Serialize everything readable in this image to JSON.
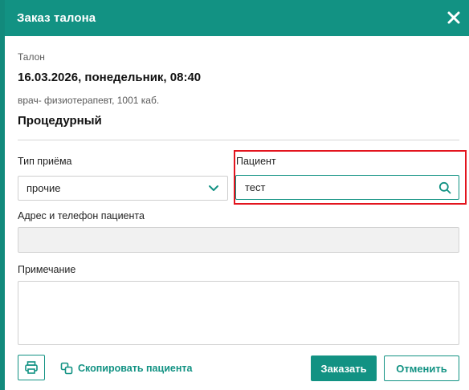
{
  "dialog": {
    "title": "Заказ талона",
    "close_icon": "close-icon"
  },
  "ticket": {
    "section_label": "Талон",
    "datetime": "16.03.2026, понедельник, 08:40",
    "doctor": "врач- физиотерапевт, 1001 каб.",
    "cabinet_name": "Процедурный"
  },
  "form": {
    "visit_type_label": "Тип приёма",
    "visit_type_value": "прочие",
    "patient_label": "Пациент",
    "patient_value": "тест",
    "address_label": "Адрес и телефон пациента",
    "address_value": "",
    "note_label": "Примечание",
    "note_value": ""
  },
  "footer": {
    "copy_patient_label": "Скопировать пациента",
    "submit_label": "Заказать",
    "cancel_label": "Отменить"
  },
  "colors": {
    "accent": "#129283",
    "highlight": "#e3141e"
  }
}
